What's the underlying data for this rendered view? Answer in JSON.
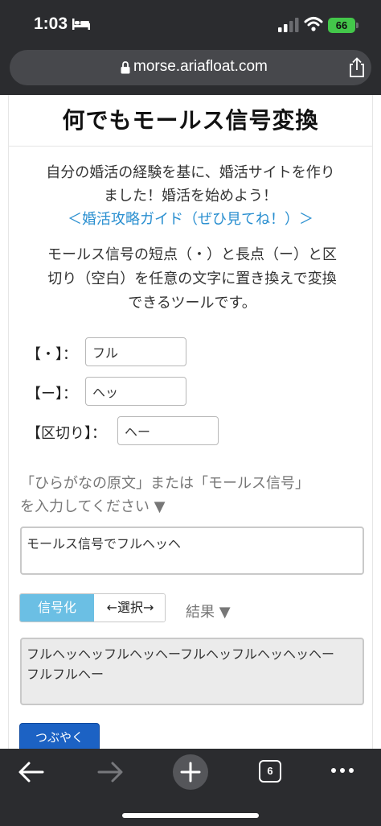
{
  "status": {
    "time": "1:03",
    "battery": "66"
  },
  "browser": {
    "url": "morse.ariafloat.com",
    "tab_count": "6"
  },
  "page": {
    "title": "何でもモールス信号変換",
    "intro_line1": "自分の婚活の経験を基に、婚活サイトを作り",
    "intro_line2": "ました！婚活を始めよう！",
    "guide_link": "＜婚活攻略ガイド（ぜひ見てね！）＞",
    "desc_line1": "モールス信号の短点（・）と長点（ー）と区",
    "desc_line2": "切り（空白）を任意の文字に置き換えで変換",
    "desc_line3": "できるツールです。"
  },
  "fields": {
    "dot_label": "【・】：",
    "dot_value": "フル",
    "dash_label": "【ー】：",
    "dash_value": "ヘッ",
    "sep_label": "【区切り】：",
    "sep_value": "ヘー"
  },
  "input": {
    "prompt_line1": "「ひらがなの原文」または「モールス信号」",
    "prompt_line2": "を入力してください ▼",
    "source_text": "モールス信号でフルヘッヘ"
  },
  "actions": {
    "encode_label": "信号化",
    "select_label": "←選択→",
    "result_label": "結果 ▼",
    "tweet_label": "つぶやく"
  },
  "result": {
    "line1": "フルヘッヘッフルヘッヘーフルヘッフルヘッヘッヘー",
    "line2": "フルフルヘー"
  }
}
